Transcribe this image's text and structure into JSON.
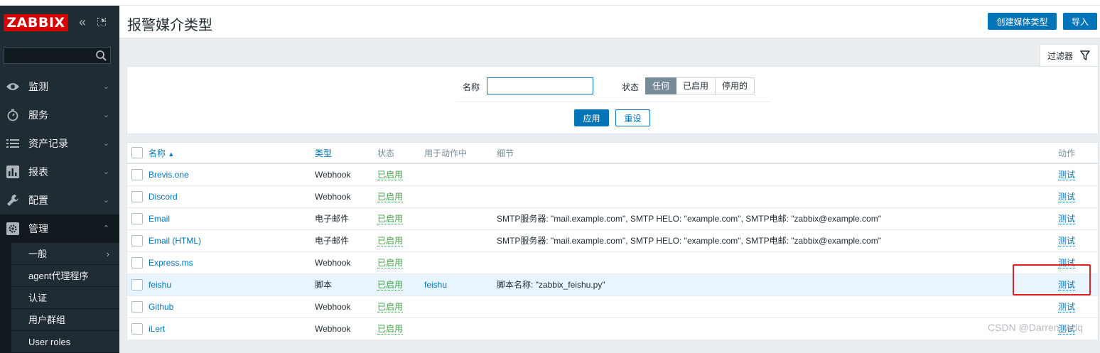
{
  "app": {
    "logo": "ZABBIX",
    "collapse_icon": "double-chevron-left-icon",
    "kiosk_icon": "kiosk-mode-icon",
    "search_placeholder": ""
  },
  "sidebar": {
    "items": [
      {
        "label": "监测",
        "icon": "eye-icon",
        "expanded": false
      },
      {
        "label": "服务",
        "icon": "stopwatch-icon",
        "expanded": false
      },
      {
        "label": "资产记录",
        "icon": "list-icon",
        "expanded": false
      },
      {
        "label": "报表",
        "icon": "bar-chart-icon",
        "expanded": false
      },
      {
        "label": "配置",
        "icon": "wrench-icon",
        "expanded": false
      },
      {
        "label": "管理",
        "icon": "gear-icon",
        "expanded": true
      }
    ],
    "subitems": [
      "一般",
      "agent代理程序",
      "认证",
      "用户群组",
      "User roles"
    ]
  },
  "header": {
    "title": "报警媒介类型",
    "create_button": "创建媒体类型",
    "import_button": "导入"
  },
  "filter": {
    "tab_label": "过滤器",
    "name_label": "名称",
    "name_value": "",
    "status_label": "状态",
    "status_options": [
      "任何",
      "已启用",
      "停用的"
    ],
    "status_selected": "任何",
    "apply_button": "应用",
    "reset_button": "重设"
  },
  "table": {
    "columns": {
      "name": "名称",
      "sort_indicator": "▲",
      "type": "类型",
      "status": "状态",
      "used_in": "用于动作中",
      "details": "细节",
      "action": "动作"
    },
    "rows": [
      {
        "name": "Brevis.one",
        "type": "Webhook",
        "status": "已启用",
        "used_in": "",
        "details": "",
        "action": "测试"
      },
      {
        "name": "Discord",
        "type": "Webhook",
        "status": "已启用",
        "used_in": "",
        "details": "",
        "action": "测试"
      },
      {
        "name": "Email",
        "type": "电子邮件",
        "status": "已启用",
        "used_in": "",
        "details": "SMTP服务器: \"mail.example.com\", SMTP HELO: \"example.com\", SMTP电邮: \"zabbix@example.com\"",
        "action": "测试"
      },
      {
        "name": "Email (HTML)",
        "type": "电子邮件",
        "status": "已启用",
        "used_in": "",
        "details": "SMTP服务器: \"mail.example.com\", SMTP HELO: \"example.com\", SMTP电邮: \"zabbix@example.com\"",
        "action": "测试"
      },
      {
        "name": "Express.ms",
        "type": "Webhook",
        "status": "已启用",
        "used_in": "",
        "details": "",
        "action": "测试"
      },
      {
        "name": "feishu",
        "type": "脚本",
        "status": "已启用",
        "used_in": "feishu",
        "details": "脚本名称: \"zabbix_feishu.py\"",
        "action": "测试",
        "highlighted": true
      },
      {
        "name": "Github",
        "type": "Webhook",
        "status": "已启用",
        "used_in": "",
        "details": "",
        "action": "测试"
      },
      {
        "name": "iLert",
        "type": "Webhook",
        "status": "已启用",
        "used_in": "",
        "details": "",
        "action": "测试"
      }
    ]
  },
  "watermark": "CSDN @Darren_wdq",
  "colors": {
    "brand_red": "#d40000",
    "primary_blue": "#0275b8",
    "sidebar": "#1f2c33",
    "enabled_green": "#429e47",
    "annotation_red": "#e02020"
  }
}
